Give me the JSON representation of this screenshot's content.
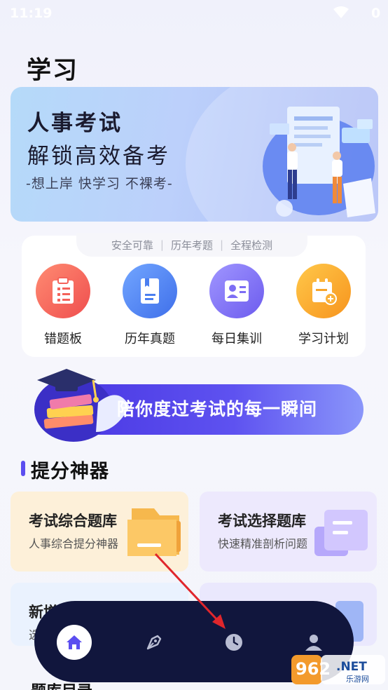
{
  "status_bar": {
    "time": "11:19",
    "battery": "0"
  },
  "page_title": "学习",
  "banner": {
    "title": "人事考试",
    "subtitle": "解锁高效备考",
    "slogan": "-想上岸 快学习 不裸考-"
  },
  "taglines": [
    "安全可靠",
    "历年考题",
    "全程检测"
  ],
  "features": [
    {
      "label": "错题板",
      "icon": "clipboard-list-icon",
      "color": "#f4625a"
    },
    {
      "label": "历年真题",
      "icon": "book-icon",
      "color": "#4b7ff0"
    },
    {
      "label": "每日集训",
      "icon": "profile-card-icon",
      "color": "#7d6ef4"
    },
    {
      "label": "学习计划",
      "icon": "calendar-plus-icon",
      "color": "#f7a42a"
    }
  ],
  "promo": {
    "text": "陪你度过考试的每一瞬间"
  },
  "section": {
    "title": "提分神器"
  },
  "tools": [
    {
      "title": "考试综合题库",
      "desc": "人事综合提分神器",
      "icon": "folder-icon"
    },
    {
      "title": "考试选择题库",
      "desc": "快速精准剖析问题",
      "icon": "document-stack-icon"
    },
    {
      "title": "新增",
      "desc": "选"
    }
  ],
  "nav": [
    {
      "name": "home",
      "icon": "home-icon",
      "active": true
    },
    {
      "name": "write",
      "icon": "pen-nib-icon",
      "active": false
    },
    {
      "name": "history",
      "icon": "clock-icon",
      "active": false
    },
    {
      "name": "profile",
      "icon": "user-icon",
      "active": false
    }
  ],
  "watermark": {
    "brand": "962.NET",
    "sub": "乐游网"
  },
  "bottom_peek": "题库目录",
  "colors": {
    "accent": "#5b4ef0",
    "nav_bg": "#11163d",
    "arrow": "#e0262c"
  }
}
